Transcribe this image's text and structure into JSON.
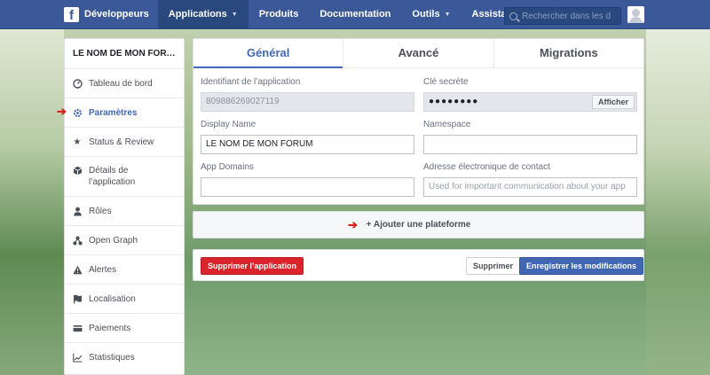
{
  "topbar": {
    "brand": "Développeurs",
    "nav": [
      {
        "label": "Applications",
        "caret": "▼",
        "active": true
      },
      {
        "label": "Produits",
        "caret": ""
      },
      {
        "label": "Documentation",
        "caret": ""
      },
      {
        "label": "Outils",
        "caret": "▼"
      },
      {
        "label": "Assistance",
        "caret": ""
      }
    ],
    "search_placeholder": "Rechercher dans les d"
  },
  "sidebar": {
    "title": "LE NOM DE MON FOR…",
    "items": [
      {
        "label": "Tableau de bord",
        "icon": "dashboard-icon"
      },
      {
        "label": "Paramètres",
        "icon": "gear-icon"
      },
      {
        "label": "Status & Review",
        "icon": "star-icon"
      },
      {
        "label": "Détails de l’application",
        "icon": "cube-icon"
      },
      {
        "label": "Rôles",
        "icon": "person-icon"
      },
      {
        "label": "Open Graph",
        "icon": "graph-icon"
      },
      {
        "label": "Alertes",
        "icon": "warning-icon"
      },
      {
        "label": "Localisation",
        "icon": "flag-icon"
      },
      {
        "label": "Paiements",
        "icon": "card-icon"
      },
      {
        "label": "Statistiques",
        "icon": "chart-icon"
      }
    ]
  },
  "tabs": [
    "Général",
    "Avancé",
    "Migrations"
  ],
  "form": {
    "app_id_label": "Identifiant de l’application",
    "app_id_value": "809886269027119",
    "secret_label": "Clé secrète",
    "secret_value": "●●●●●●●●",
    "show_button": "Afficher",
    "display_name_label": "Display Name",
    "display_name_value": "LE NOM DE MON FORUM",
    "namespace_label": "Namespace",
    "namespace_value": "",
    "app_domains_label": "App Domains",
    "app_domains_value": "",
    "contact_label": "Adresse électronique de contact",
    "contact_placeholder": "Used for important communication about your app"
  },
  "add_platform": "+ Ajouter une plateforme",
  "actions": {
    "delete": "Supprimer l’application",
    "cancel": "Supprimer",
    "save": "Enregistrer les modifications"
  },
  "colors": {
    "topbar": "#3b5998",
    "accent": "#4267b2",
    "delete": "#d8242a",
    "arrow": "#e0201a"
  }
}
